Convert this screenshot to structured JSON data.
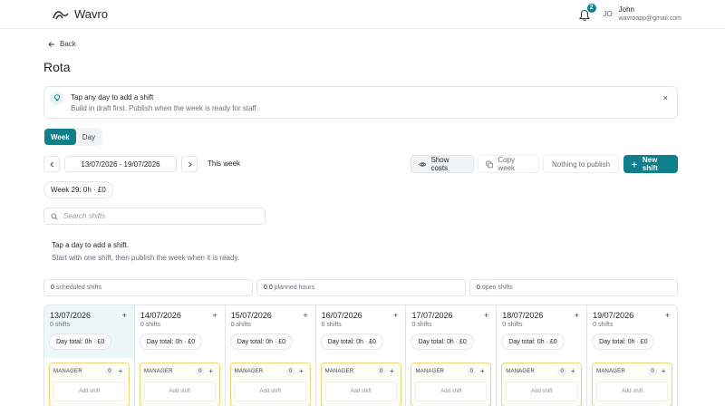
{
  "app": {
    "name": "Wavro"
  },
  "header": {
    "notifications": "2",
    "avatar_initials": "JO",
    "user_name": "John",
    "user_email": "wavroapp@gmail.com"
  },
  "nav": {
    "back_label": "Back"
  },
  "page": {
    "title": "Rota"
  },
  "tip": {
    "title": "Tap any day to add a shift",
    "subtitle": "Build in draft first. Publish when the week is ready for staff.",
    "close": "×"
  },
  "view_toggle": {
    "week": "Week",
    "day": "Day"
  },
  "week_nav": {
    "range": "13/07/2026 - 19/07/2026",
    "this_week": "This week"
  },
  "actions": {
    "show_costs": "Show costs",
    "copy_week": "Copy week",
    "nothing_to_publish": "Nothing to publish",
    "new_shift": "New shift"
  },
  "week_summary": "Week 29: 0h · £0",
  "search": {
    "placeholder": "Search shifts"
  },
  "hint": {
    "title": "Tap a day to add a shift.",
    "subtitle": "Start with one shift, then publish the week when it is ready."
  },
  "stats": {
    "scheduled_value": "0",
    "scheduled_label": "scheduled shifts",
    "planned_value": "0.0",
    "planned_label": "planned hours",
    "open_value": "0",
    "open_label": "open shifts"
  },
  "days": [
    {
      "date": "13/07/2026",
      "shifts": "0 shifts",
      "total": "Day total: 0h · £0",
      "role": "MANAGER",
      "role_count": "0",
      "add": "Add shift",
      "plus": "+"
    },
    {
      "date": "14/07/2026",
      "shifts": "0 shifts",
      "total": "Day total: 0h · £0",
      "role": "MANAGER",
      "role_count": "0",
      "add": "Add shift",
      "plus": "+"
    },
    {
      "date": "15/07/2026",
      "shifts": "0 shifts",
      "total": "Day total: 0h · £0",
      "role": "MANAGER",
      "role_count": "0",
      "add": "Add shift",
      "plus": "+"
    },
    {
      "date": "16/07/2026",
      "shifts": "0 shifts",
      "total": "Day total: 0h · £0",
      "role": "MANAGER",
      "role_count": "0",
      "add": "Add shift",
      "plus": "+"
    },
    {
      "date": "17/07/2026",
      "shifts": "0 shifts",
      "total": "Day total: 0h · £0",
      "role": "MANAGER",
      "role_count": "0",
      "add": "Add shift",
      "plus": "+"
    },
    {
      "date": "18/07/2026",
      "shifts": "0 shifts",
      "total": "Day total: 0h · £0",
      "role": "MANAGER",
      "role_count": "0",
      "add": "Add shift",
      "plus": "+"
    },
    {
      "date": "19/07/2026",
      "shifts": "0 shifts",
      "total": "Day total: 0h · £0",
      "role": "MANAGER",
      "role_count": "0",
      "add": "Add shift",
      "plus": "+"
    }
  ],
  "colors": {
    "accent": "#0f7f8c",
    "role_border": "#e8d87a",
    "today_bg": "#eef7f8"
  }
}
